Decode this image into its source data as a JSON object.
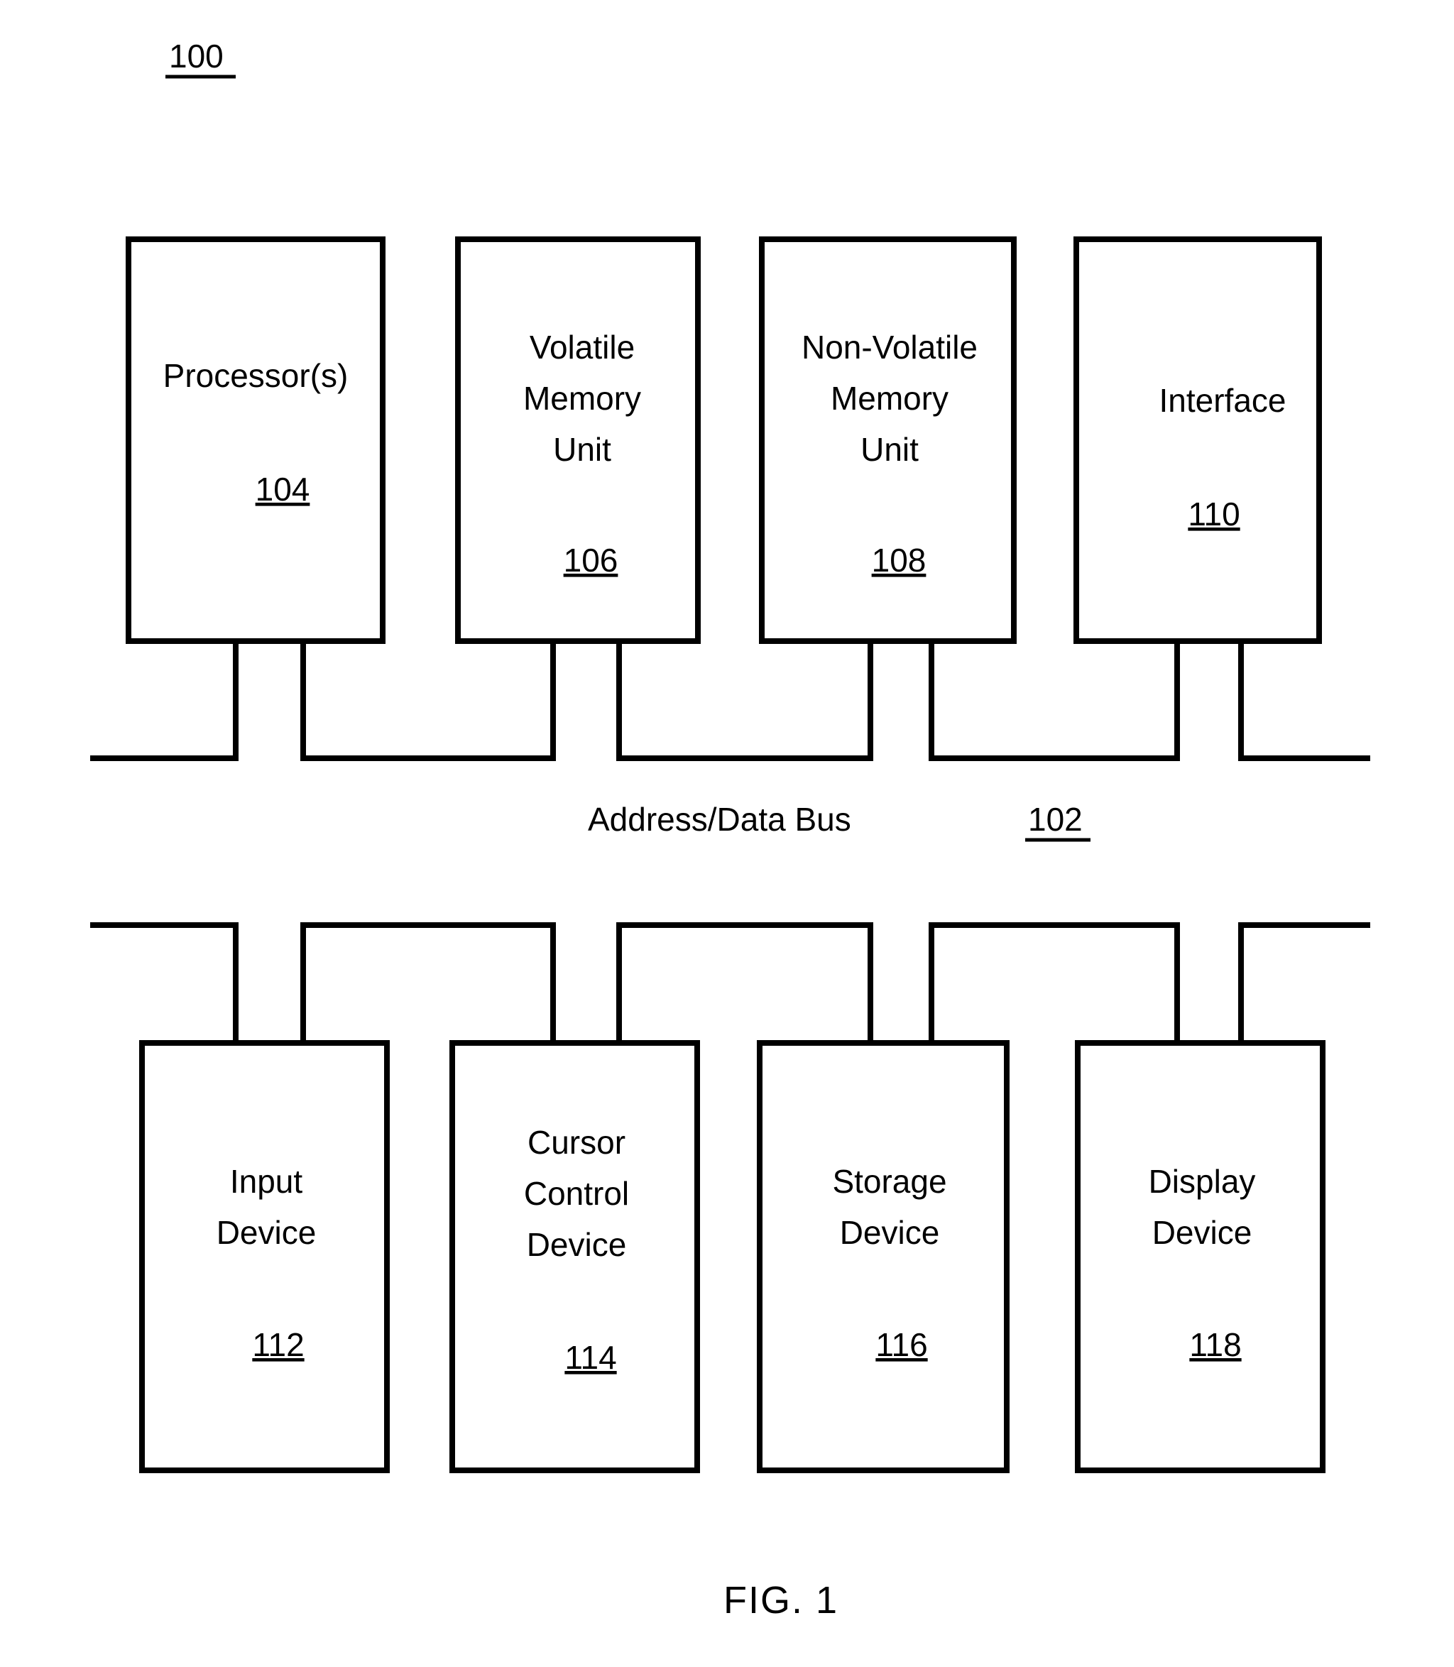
{
  "figure": {
    "top_reference": "100",
    "caption": "FIG. 1",
    "bus": {
      "label": "Address/Data Bus",
      "reference": "102"
    },
    "row1": [
      {
        "lines": [
          "Processor(s)"
        ],
        "reference": "104"
      },
      {
        "lines": [
          "Volatile",
          "Memory",
          "Unit"
        ],
        "reference": "106"
      },
      {
        "lines": [
          "Non-Volatile",
          "Memory",
          "Unit"
        ],
        "reference": "108"
      },
      {
        "lines": [
          "Interface"
        ],
        "reference": "110"
      }
    ],
    "row2": [
      {
        "lines": [
          "Input",
          "Device"
        ],
        "reference": "112"
      },
      {
        "lines": [
          "Cursor",
          "Control",
          "Device"
        ],
        "reference": "114"
      },
      {
        "lines": [
          "Storage",
          "Device"
        ],
        "reference": "116"
      },
      {
        "lines": [
          "Display",
          "Device"
        ],
        "reference": "118"
      }
    ],
    "colors": {
      "ink": "#000000",
      "paper": "#ffffff"
    }
  }
}
